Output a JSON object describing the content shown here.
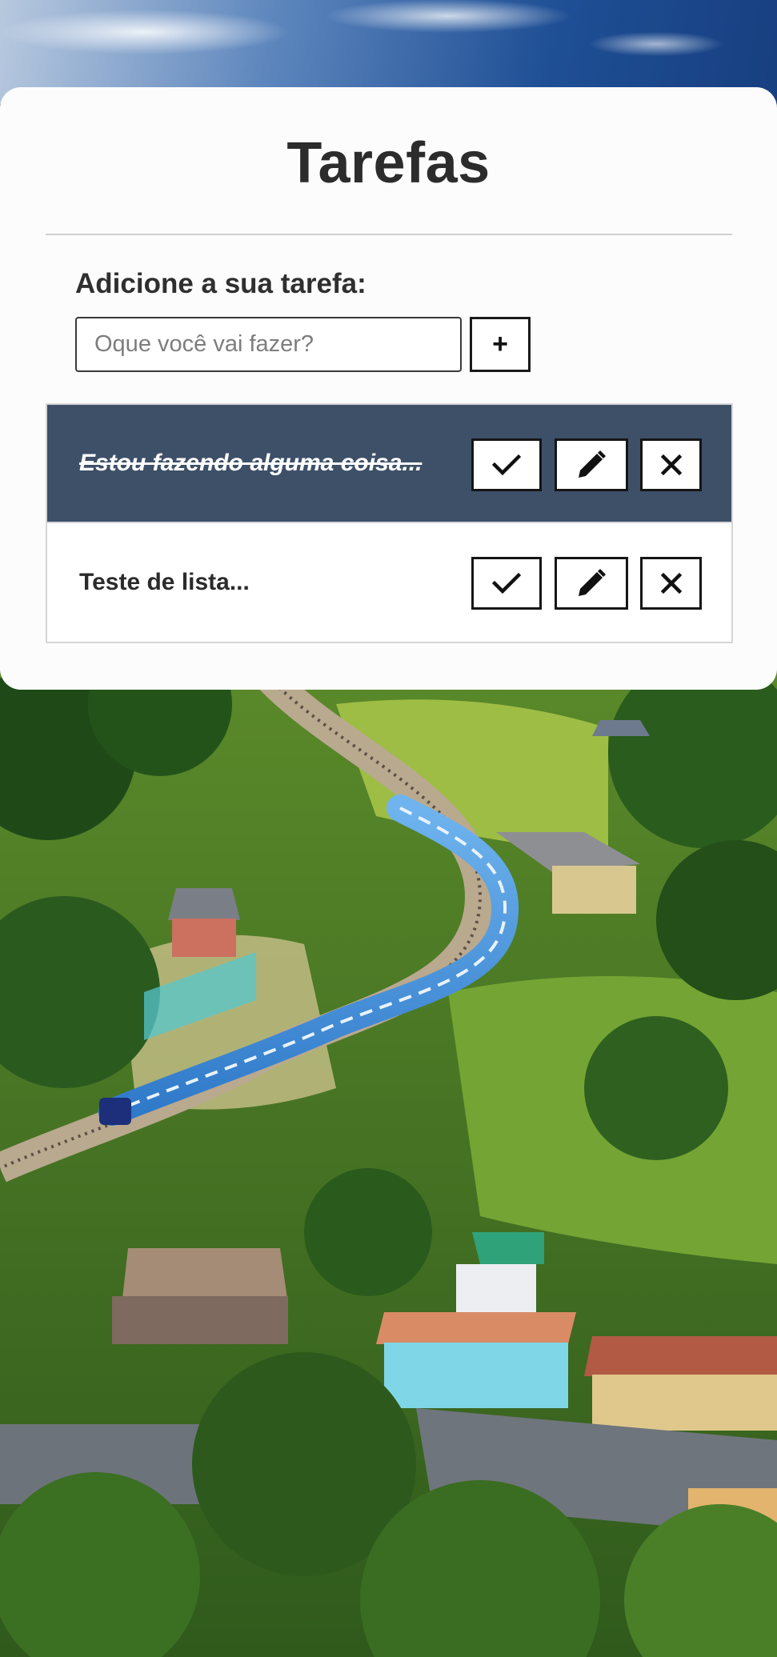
{
  "app": {
    "title": "Tarefas"
  },
  "form": {
    "label": "Adicione a sua tarefa:",
    "input_value": "",
    "input_placeholder": "Oque você vai fazer?",
    "add_button_label": "+"
  },
  "tasks": [
    {
      "text": "Estou fazendo alguma coisa...",
      "completed": true
    },
    {
      "text": "Teste de lista...",
      "completed": false
    }
  ],
  "actions": {
    "complete_icon": "check-icon",
    "edit_icon": "pencil-icon",
    "delete_icon": "close-icon"
  },
  "colors": {
    "completed_row_bg": "#3d5068",
    "card_bg": "#fcfcfd",
    "text_primary": "#2c2c2c"
  },
  "background": {
    "subject": "blue train curving through green hills village"
  }
}
